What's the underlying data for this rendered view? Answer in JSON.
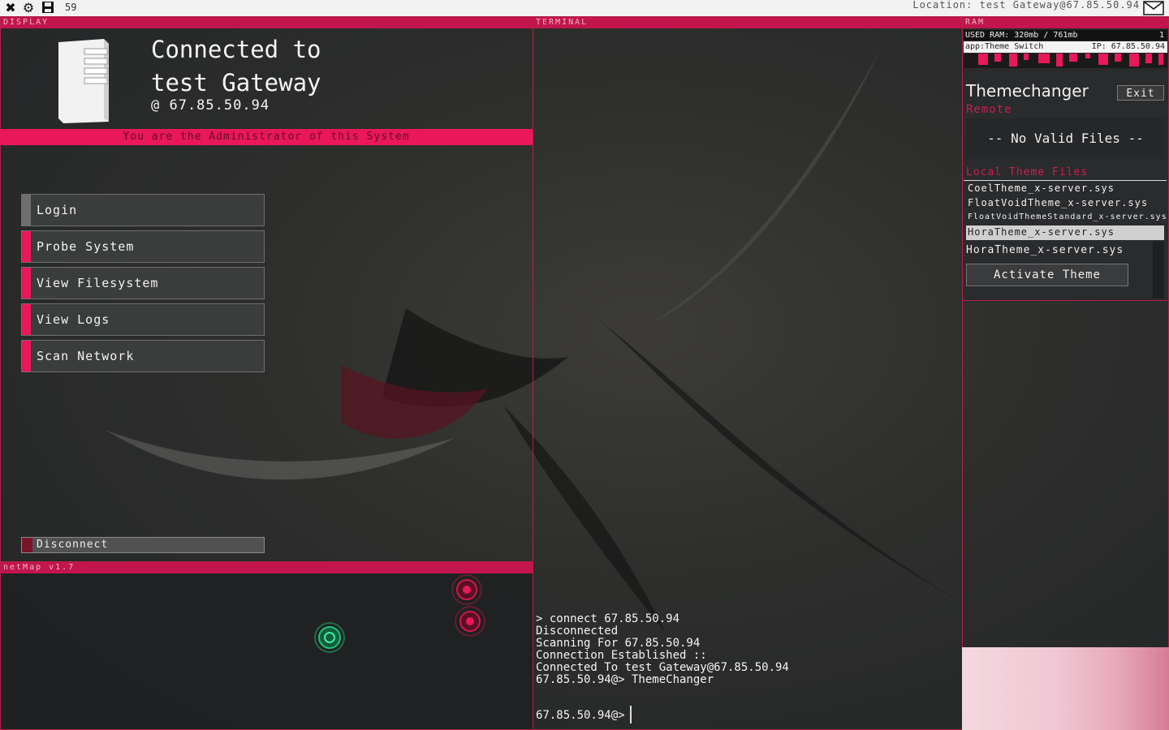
{
  "topbar": {
    "counter": "59",
    "location": "Location: test Gateway@67.85.50.94"
  },
  "display": {
    "title": "DISPLAY",
    "connected_line1": "Connected to",
    "connected_line2": "test Gateway",
    "ip_line": "@  67.85.50.94",
    "admin_banner": "You are the Administrator of this System",
    "menu": [
      {
        "label": "Login",
        "stripe": "#6e6e6e"
      },
      {
        "label": "Probe System",
        "stripe": "#e8185a"
      },
      {
        "label": "View Filesystem",
        "stripe": "#e8185a"
      },
      {
        "label": "View Logs",
        "stripe": "#e8185a"
      },
      {
        "label": "Scan Network",
        "stripe": "#e8185a"
      }
    ],
    "disconnect": "Disconnect"
  },
  "netmap": {
    "title": "netMap v1.7"
  },
  "terminal": {
    "title": "TERMINAL",
    "lines": [
      "> connect 67.85.50.94",
      "Disconnected",
      "Scanning For 67.85.50.94",
      "Connection Established ::",
      "Connected To test Gateway@67.85.50.94",
      "67.85.50.94@> ThemeChanger"
    ],
    "prompt": "67.85.50.94@>"
  },
  "ram": {
    "title": "RAM",
    "used": "USED RAM: 320mb / 761mb",
    "count": "1",
    "app": "app:Theme Switch",
    "ip": "IP: 67.85.50.94"
  },
  "themechanger": {
    "title": "Themechanger",
    "exit": "Exit",
    "remote": "Remote",
    "no_valid": "-- No Valid Files --",
    "local_header": "Local Theme Files",
    "files": [
      "CoelTheme_x-server.sys",
      "FloatVoidTheme_x-server.sys",
      "FloatVoidThemeStandard_x-server.sys",
      "HoraTheme_x-server.sys"
    ],
    "selected": "HoraTheme_x-server.sys",
    "activate": "Activate Theme"
  },
  "colors": {
    "accent": "#e8185a",
    "panel_border": "#b0204a",
    "node_green": "#1fc27a",
    "node_red": "#d0184c"
  }
}
